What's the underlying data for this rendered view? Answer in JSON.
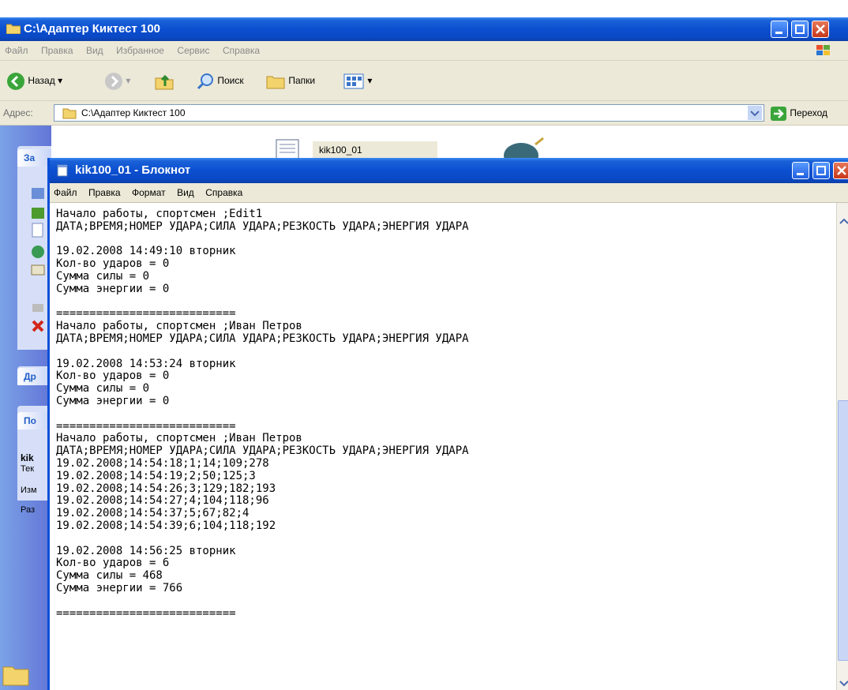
{
  "explorer": {
    "title": "C:\\Адаптер Киктест 100",
    "menu": [
      "Файл",
      "Правка",
      "Вид",
      "Избранное",
      "Сервис",
      "Справка"
    ],
    "toolbar": {
      "back": "Назад",
      "search": "Поиск",
      "folders": "Папки"
    },
    "address_label": "Адрес:",
    "address_value": "C:\\Адаптер Киктест 100",
    "go_label": "Переход",
    "file_name": "kik100_01",
    "taskpane": {
      "box1_title": "За",
      "box2_title": "Др",
      "box3_title": "По",
      "details_name": "kik",
      "details_lines": [
        "Тек",
        "Изм",
        "Раз"
      ]
    }
  },
  "notepad": {
    "title": "kik100_01 - Блокнот",
    "menu": [
      "Файл",
      "Правка",
      "Формат",
      "Вид",
      "Справка"
    ],
    "content": "Начало работы, спортсмен ;Edit1\nДАТА;ВРЕМЯ;НОМЕР УДАРА;СИЛА УДАРА;РЕЗКОСТЬ УДАРА;ЭНЕРГИЯ УДАРА\n\n19.02.2008 14:49:10 вторник\nКол-во ударов = 0\nСумма силы = 0\nСумма энергии = 0\n\n===========================\nНачало работы, спортсмен ;Иван Петров\nДАТА;ВРЕМЯ;НОМЕР УДАРА;СИЛА УДАРА;РЕЗКОСТЬ УДАРА;ЭНЕРГИЯ УДАРА\n\n19.02.2008 14:53:24 вторник\nКол-во ударов = 0\nСумма силы = 0\nСумма энергии = 0\n\n===========================\nНачало работы, спортсмен ;Иван Петров\nДАТА;ВРЕМЯ;НОМЕР УДАРА;СИЛА УДАРА;РЕЗКОСТЬ УДАРА;ЭНЕРГИЯ УДАРА\n19.02.2008;14:54:18;1;14;109;278\n19.02.2008;14:54:19;2;50;125;3\n19.02.2008;14:54:26;3;129;182;193\n19.02.2008;14:54:27;4;104;118;96\n19.02.2008;14:54:37;5;67;82;4\n19.02.2008;14:54:39;6;104;118;192\n\n19.02.2008 14:56:25 вторник\nКол-во ударов = 6\nСумма силы = 468\nСумма энергии = 766\n\n==========================="
  },
  "colors": {
    "title_blue": "#0b4fd0",
    "xp_beige": "#ece9d8",
    "close_red": "#c7361a"
  }
}
